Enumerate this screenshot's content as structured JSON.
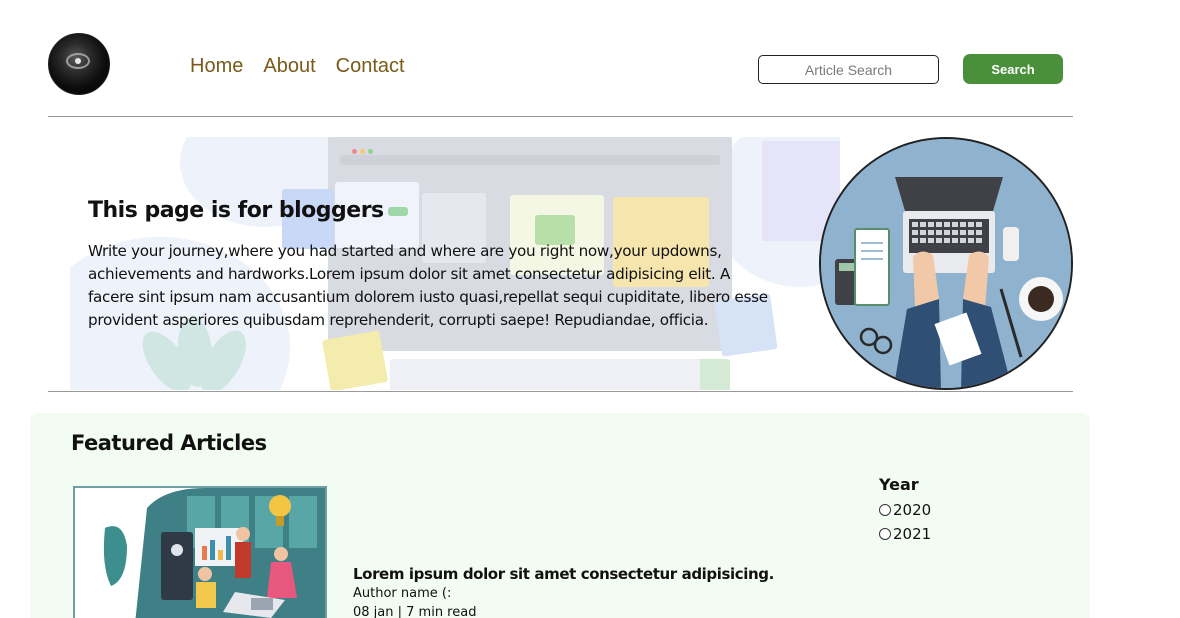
{
  "nav": {
    "items": [
      {
        "label": "Home"
      },
      {
        "label": "About"
      },
      {
        "label": "Contact"
      }
    ]
  },
  "search": {
    "placeholder": "Article Search",
    "value": "",
    "button_label": "Search"
  },
  "hero": {
    "title": "This page is for bloggers",
    "text": "Write your journey,where you had started and where are you right now,your updowns, achievements and hardworks.Lorem ipsum dolor sit amet consectetur adipisicing elit. A facere sint ipsum nam accusantium dolorem iusto quasi,repellat sequi cupiditate, libero esse provident asperiores quibusdam reprehenderit, corrupti saepe! Repudiandae, officia."
  },
  "featured": {
    "title": "Featured Articles",
    "article": {
      "title": "Lorem ipsum dolor sit amet consectetur adipisicing.",
      "author": "Author name (:",
      "meta": "08 jan | 7 min read"
    },
    "filter": {
      "label": "Year",
      "options": [
        {
          "label": "2020"
        },
        {
          "label": "2021"
        }
      ]
    }
  },
  "colors": {
    "nav_link": "#7a5a1a",
    "search_button": "#4a8f3a",
    "featured_bg": "#f3fcf2",
    "divider": "#9a9a9a"
  },
  "icons": {
    "logo": "logo-icon",
    "hero_illustration": "laptop-desk-illustration",
    "article_illustration": "team-meeting-illustration"
  }
}
